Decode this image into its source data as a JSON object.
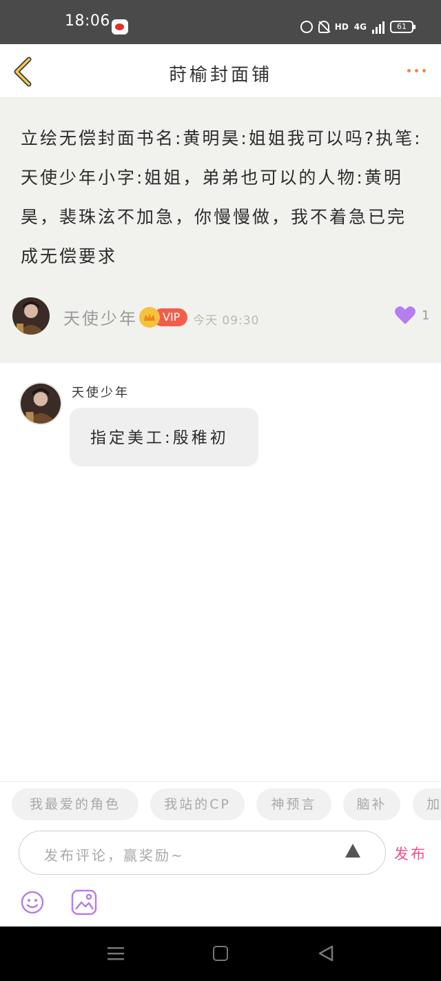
{
  "status_bar": {
    "time": "18:06",
    "network": "4G",
    "battery": "61",
    "icons": [
      "weibo-icon",
      "alarm-icon",
      "mute-bell-icon",
      "hd-icon",
      "signal-icon",
      "battery-icon"
    ]
  },
  "header": {
    "title": "莳榆封面铺",
    "back_icon": "chevron-left-icon",
    "more_icon": "more-dots-icon"
  },
  "post": {
    "text": "立绘无偿封面书名:黄明昊:姐姐我可以吗?执笔:天使少年小字:姐姐，弟弟也可以的人物:黄明昊，裴珠泫不加急，你慢慢做，我不着急已完成无偿要求",
    "author": "天使少年",
    "vip_label": "VIP",
    "time": "今天 09:30",
    "likes": "1"
  },
  "comment": {
    "author": "天使少年",
    "text": "指定美工:殷稚初"
  },
  "tags": [
    "我最爱的角色",
    "我站的CP",
    "神预言",
    "脑补",
    "加"
  ],
  "input": {
    "placeholder": "发布评论，赢奖励~",
    "publish_label": "发布"
  },
  "colors": {
    "accent_pink": "#f0508c",
    "vip_red": "#f25d4b",
    "crown_gold": "#f6c23e",
    "heart_purple": "#b57df0",
    "back_yellow": "#f2c94c",
    "dots_orange": "#f1884b"
  }
}
